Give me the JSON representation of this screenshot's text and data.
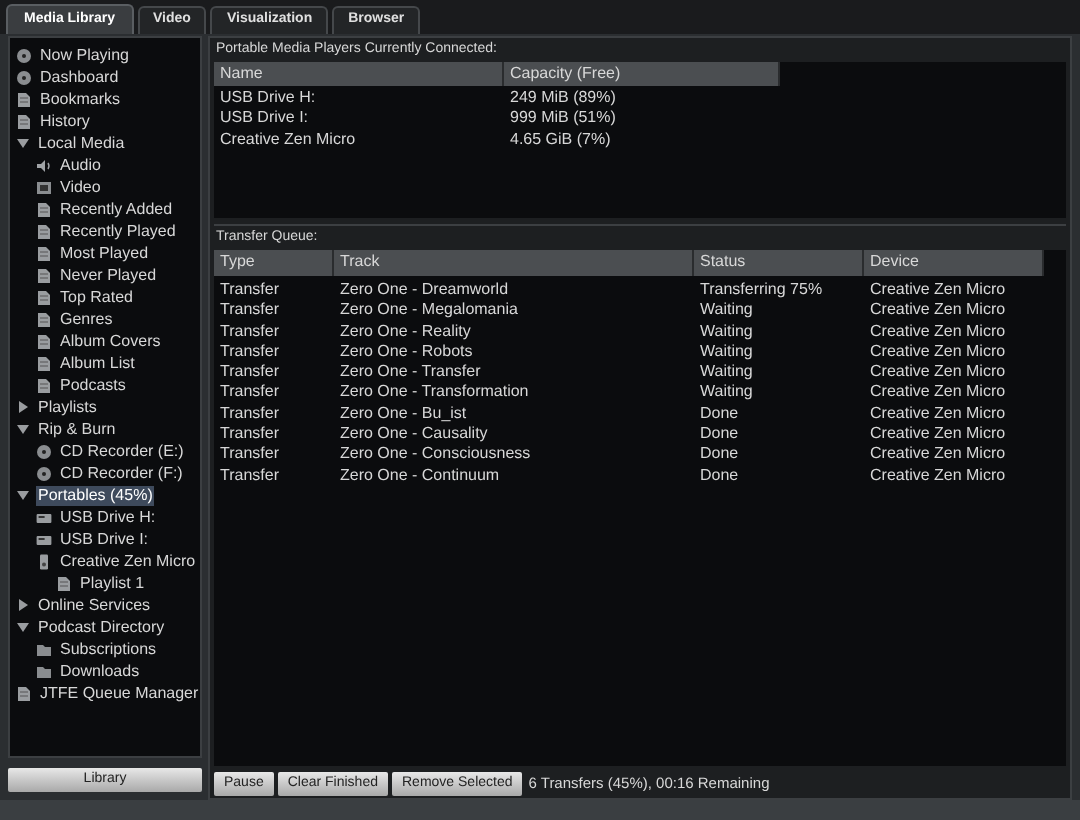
{
  "tabs": [
    {
      "label": "Media Library",
      "selected": true
    },
    {
      "label": "Video",
      "selected": false
    },
    {
      "label": "Visualization",
      "selected": false
    },
    {
      "label": "Browser",
      "selected": false
    }
  ],
  "sidebar": {
    "items": [
      {
        "label": "Now Playing",
        "kind": "disc",
        "selected": false
      },
      {
        "label": "Dashboard",
        "kind": "disc",
        "selected": false
      },
      {
        "label": "Bookmarks",
        "kind": "page",
        "selected": false
      },
      {
        "label": "History",
        "kind": "page",
        "selected": false
      },
      {
        "label": "Local Media",
        "expanded": true,
        "selected": false,
        "children": [
          {
            "label": "Audio",
            "kind": "speaker",
            "selected": false
          },
          {
            "label": "Video",
            "kind": "film",
            "selected": false
          },
          {
            "label": "Recently Added",
            "kind": "page",
            "selected": false
          },
          {
            "label": "Recently Played",
            "kind": "page",
            "selected": false
          },
          {
            "label": "Most Played",
            "kind": "page",
            "selected": false
          },
          {
            "label": "Never Played",
            "kind": "page",
            "selected": false
          },
          {
            "label": "Top Rated",
            "kind": "page",
            "selected": false
          },
          {
            "label": "Genres",
            "kind": "page",
            "selected": false
          },
          {
            "label": "Album Covers",
            "kind": "page",
            "selected": false
          },
          {
            "label": "Album List",
            "kind": "page",
            "selected": false
          },
          {
            "label": "Podcasts",
            "kind": "page",
            "selected": false
          }
        ]
      },
      {
        "label": "Playlists",
        "expanded": false,
        "selected": false
      },
      {
        "label": "Rip & Burn",
        "expanded": true,
        "selected": false,
        "children": [
          {
            "label": "CD Recorder (E:)",
            "kind": "disc",
            "selected": false
          },
          {
            "label": "CD Recorder (F:)",
            "kind": "disc",
            "selected": false
          }
        ]
      },
      {
        "label": "Portables (45%)",
        "expanded": true,
        "selected": true,
        "children": [
          {
            "label": "USB Drive H:",
            "kind": "drive",
            "selected": false
          },
          {
            "label": "USB Drive I:",
            "kind": "drive",
            "selected": false
          },
          {
            "label": "Creative Zen Micro",
            "kind": "device",
            "selected": false,
            "children": [
              {
                "label": "Playlist 1",
                "kind": "page",
                "selected": false
              }
            ]
          }
        ]
      },
      {
        "label": "Online Services",
        "expanded": false,
        "selected": false
      },
      {
        "label": "Podcast Directory",
        "expanded": true,
        "selected": false,
        "children": [
          {
            "label": "Subscriptions",
            "kind": "folder",
            "selected": false
          },
          {
            "label": "Downloads",
            "kind": "folder",
            "selected": false
          }
        ]
      },
      {
        "label": "JTFE Queue Manager",
        "kind": "page",
        "selected": false
      }
    ],
    "button": "Library"
  },
  "devices": {
    "title": "Portable Media Players Currently Connected:",
    "columns": [
      "Name",
      "Capacity (Free)"
    ],
    "rows": [
      [
        "USB Drive H:",
        "249 MiB (89%)"
      ],
      [
        "USB Drive I:",
        "999 MiB (51%)"
      ],
      [
        "Creative Zen Micro",
        "4.65 GiB (7%)"
      ]
    ]
  },
  "queue": {
    "title": "Transfer Queue:",
    "columns": [
      "Type",
      "Track",
      "Status",
      "Device"
    ],
    "rows": [
      [
        "Transfer",
        "Zero One - Dreamworld",
        "Transferring 75%",
        "Creative Zen Micro"
      ],
      [
        "Transfer",
        "Zero One - Megalomania",
        "Waiting",
        "Creative Zen Micro"
      ],
      [
        "Transfer",
        "Zero One - Reality",
        "Waiting",
        "Creative Zen Micro"
      ],
      [
        "Transfer",
        "Zero One - Robots",
        "Waiting",
        "Creative Zen Micro"
      ],
      [
        "Transfer",
        "Zero One - Transfer",
        "Waiting",
        "Creative Zen Micro"
      ],
      [
        "Transfer",
        "Zero One - Transformation",
        "Waiting",
        "Creative Zen Micro"
      ],
      [
        "Transfer",
        "Zero One - Bu_ist",
        "Done",
        "Creative Zen Micro"
      ],
      [
        "Transfer",
        "Zero One - Causality",
        "Done",
        "Creative Zen Micro"
      ],
      [
        "Transfer",
        "Zero One - Consciousness",
        "Done",
        "Creative Zen Micro"
      ],
      [
        "Transfer",
        "Zero One - Continuum",
        "Done",
        "Creative Zen Micro"
      ]
    ],
    "buttons": [
      "Pause",
      "Clear Finished",
      "Remove Selected"
    ],
    "status": "6 Transfers (45%), 00:16 Remaining"
  }
}
